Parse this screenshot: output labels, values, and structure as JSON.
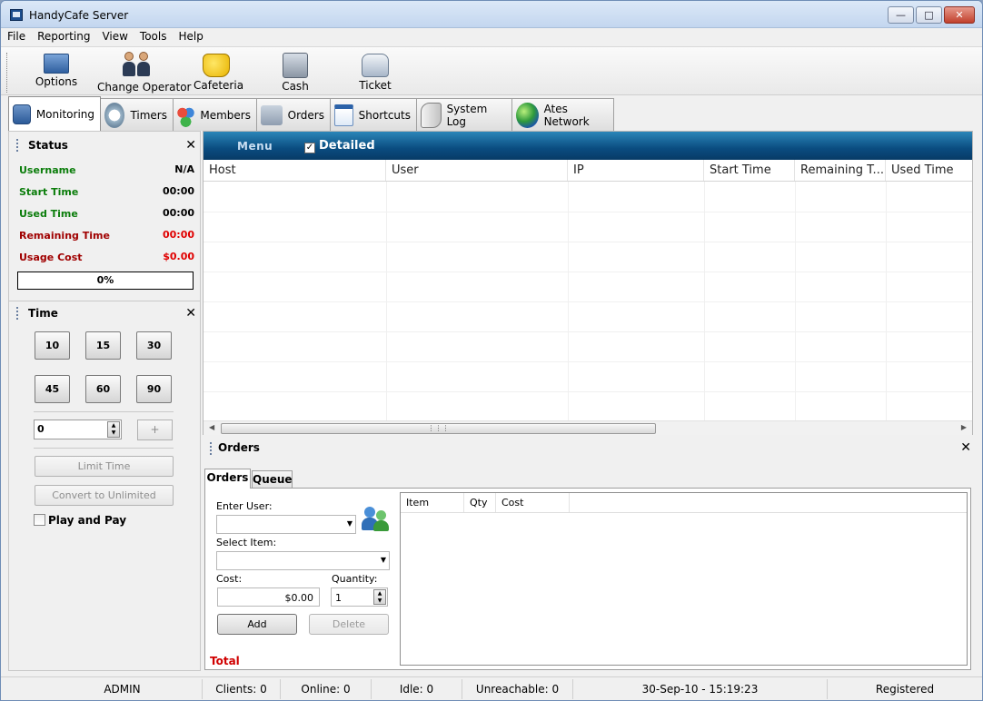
{
  "window": {
    "title": "HandyCafe Server"
  },
  "menu": [
    "File",
    "Reporting",
    "View",
    "Tools",
    "Help"
  ],
  "toolbar": {
    "options": "Options",
    "change_operator": "Change Operator",
    "cafeteria": "Cafeteria",
    "cash": "Cash",
    "ticket": "Ticket"
  },
  "tabs": [
    "Monitoring",
    "Timers",
    "Members",
    "Orders",
    "Shortcuts",
    "System Log",
    "Ates Network"
  ],
  "status": {
    "title": "Status",
    "username_label": "Username",
    "username_value": "N/A",
    "start_label": "Start Time",
    "start_value": "00:00",
    "used_label": "Used Time",
    "used_value": "00:00",
    "remaining_label": "Remaining Time",
    "remaining_value": "00:00",
    "cost_label": "Usage Cost",
    "cost_value": "$0.00",
    "progress": "0%",
    "progress_fraction": 0
  },
  "time": {
    "title": "Time",
    "presets": [
      "10",
      "15",
      "30",
      "45",
      "60",
      "90"
    ],
    "spin_value": "0",
    "plus_label": "+",
    "limit_label": "Limit Time",
    "convert_label": "Convert to Unlimited",
    "play_pay_label": "Play and Pay"
  },
  "monitor": {
    "menu_label": "Menu",
    "detailed_label": "Detailed",
    "detailed_checked": true,
    "columns": [
      "Host",
      "User",
      "IP",
      "Start Time",
      "Remaining T...",
      "Used Time"
    ]
  },
  "orders": {
    "title": "Orders",
    "tabs": [
      "Orders",
      "Queue"
    ],
    "enter_user_label": "Enter User:",
    "select_item_label": "Select Item:",
    "cost_label": "Cost:",
    "cost_value": "$0.00",
    "quantity_label": "Quantity:",
    "quantity_value": "1",
    "add_label": "Add",
    "delete_label": "Delete",
    "total_label": "Total",
    "list_columns": [
      "Item",
      "Qty",
      "Cost"
    ]
  },
  "statusbar": {
    "operator": "ADMIN",
    "clients": "Clients: 0",
    "online": "Online: 0",
    "idle": "Idle: 0",
    "unreachable": "Unreachable: 0",
    "datetime": "30-Sep-10 - 15:19:23",
    "registered": "Registered"
  },
  "colors": {
    "label_green": "#0b7d0b",
    "label_red": "#a00000",
    "cost_red": "#e00000",
    "header_blue": "#0a4c80"
  }
}
